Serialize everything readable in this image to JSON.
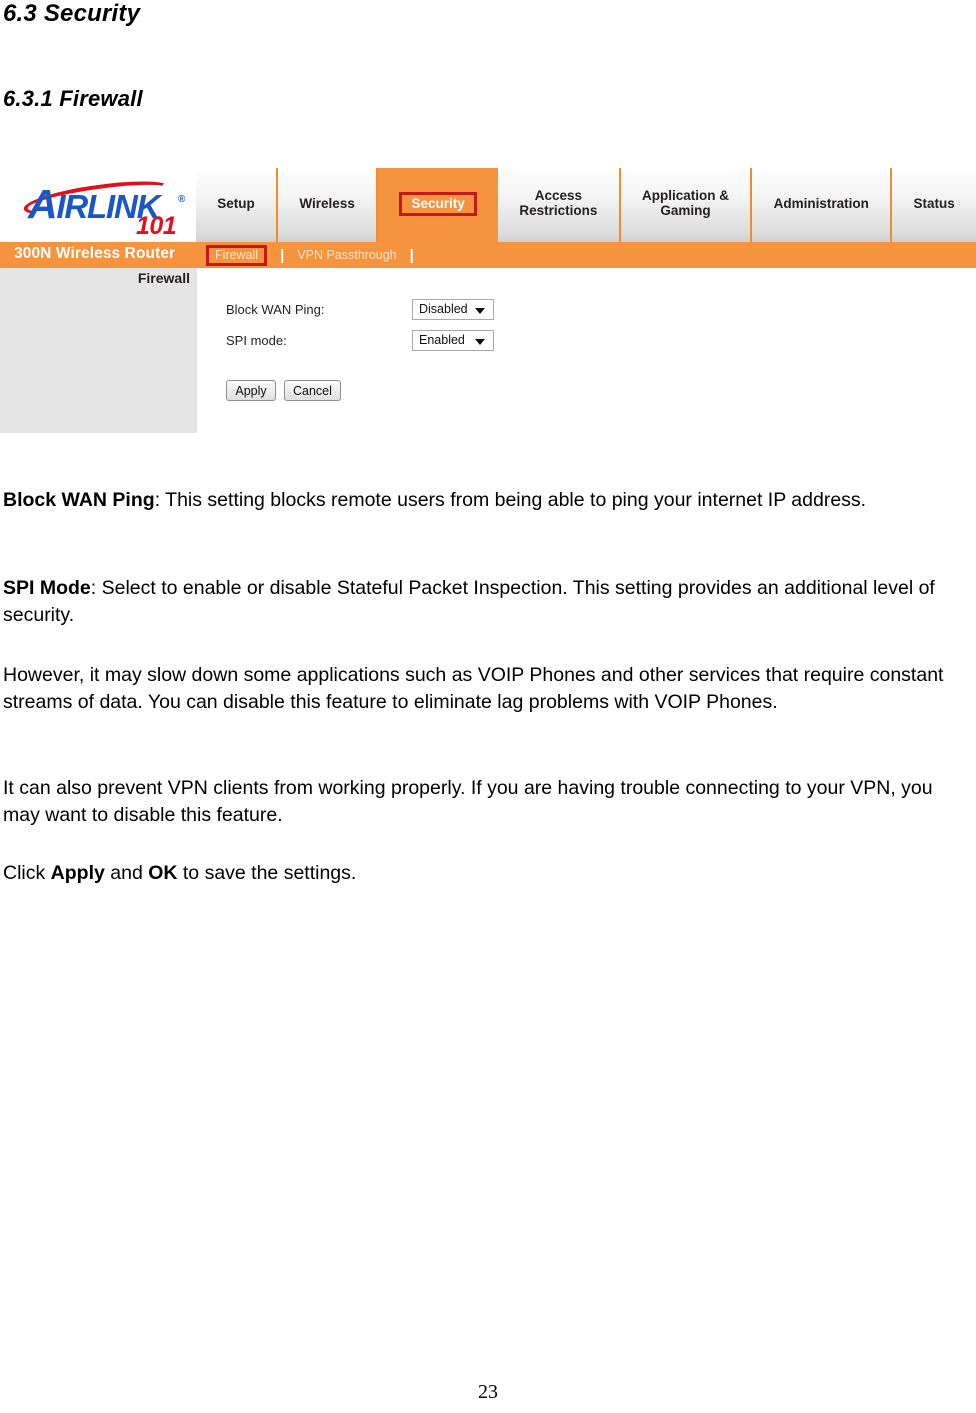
{
  "document": {
    "heading_section": "6.3 Security",
    "heading_subsection": "6.3.1 Firewall",
    "page_number": "23"
  },
  "router_ui": {
    "logo": {
      "brand_main": "IRLINK",
      "brand_cap": "A",
      "brand_suffix": "101",
      "registered_mark": "®"
    },
    "model_bar": "300N Wireless Router",
    "tabs": [
      {
        "label": "Setup",
        "active": false
      },
      {
        "label": "Wireless",
        "active": false
      },
      {
        "label": "Security",
        "active": true
      },
      {
        "label": "Access Restrictions",
        "line1": "Access",
        "line2": "Restrictions",
        "active": false
      },
      {
        "label": "Application & Gaming",
        "line1": "Application &",
        "line2": "Gaming",
        "active": false
      },
      {
        "label": "Administration",
        "active": false
      },
      {
        "label": "Status",
        "active": false
      }
    ],
    "subnav": [
      {
        "label": "Firewall",
        "current": true
      },
      {
        "label": "VPN Passthrough",
        "current": false
      }
    ],
    "subnav_separator": "|",
    "section_title": "Firewall",
    "form": {
      "fields": [
        {
          "label": "Block WAN Ping:",
          "value": "Disabled"
        },
        {
          "label": "SPI mode:",
          "value": "Enabled"
        }
      ]
    },
    "buttons": {
      "apply": "Apply",
      "cancel": "Cancel"
    },
    "colors": {
      "accent_orange": "#F5933F",
      "highlight_red": "#C21A16",
      "logo_blue": "#1A56C4",
      "logo_red": "#E01020",
      "panel_gray": "#E6E5E5"
    }
  },
  "body_copy": {
    "p1_bold": "Block WAN Ping",
    "p1_rest": ":  This setting blocks remote users from being able to ping your internet IP address.",
    "p2_bold": "SPI Mode",
    "p2_rest": ": Select to enable or disable Stateful Packet Inspection.  This setting provides an additional level of security.",
    "p3": "However, it may slow down some applications such as VOIP Phones and other services that require constant streams of data.  You can disable this feature to eliminate lag problems with VOIP Phones.",
    "p4": "It can also prevent VPN clients from working properly.  If you are having trouble connecting to your VPN, you may want to disable this feature.",
    "p5_pre": "Click ",
    "p5_bold1": "Apply",
    "p5_mid": " and ",
    "p5_bold2": "OK",
    "p5_post": " to save the settings."
  }
}
